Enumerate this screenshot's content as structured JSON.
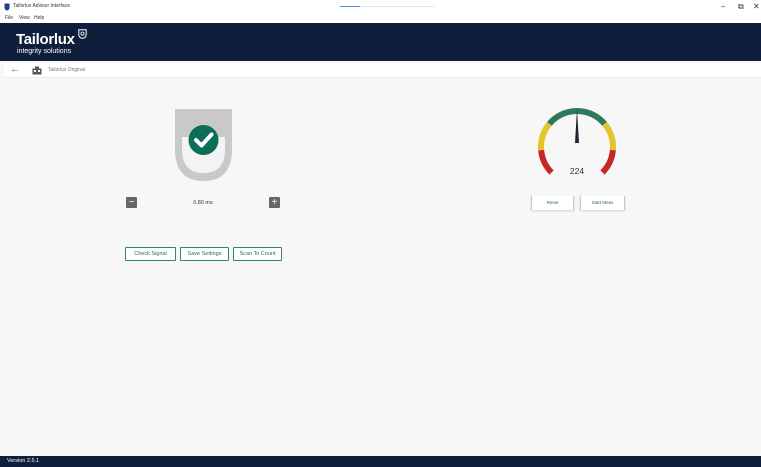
{
  "window": {
    "title": "Tailorlux Advisor Interface",
    "minimize_glyph": "–",
    "restore_glyph": "⧉",
    "close_glyph": "✕"
  },
  "menu": {
    "items": [
      {
        "label": "File"
      },
      {
        "label": "View"
      },
      {
        "label": "Help"
      }
    ]
  },
  "brand": {
    "name": "Tailorlux",
    "tagline": "integrity solutions",
    "color": "#0f1e3a"
  },
  "breadcrumb": {
    "back_glyph": "←",
    "device_label": "Tailorlux Original"
  },
  "status_indicator": {
    "state": "check-ok",
    "accent_color": "#0d6e57"
  },
  "stepper": {
    "minus_glyph": "−",
    "plus_glyph": "+",
    "value": "0.80 ms"
  },
  "gauge": {
    "value": 224,
    "value_label": "224",
    "needle_fraction": 0.5,
    "zones": [
      "#c62828",
      "#e2c52a",
      "#2d7a5a",
      "#e2c52a",
      "#c62828"
    ]
  },
  "gauge_actions": {
    "reset_label": "Reset",
    "start_label": "Start Meas"
  },
  "actions": {
    "check_signal_label": "Check Signal",
    "save_settings_label": "Save Settings",
    "scan_to_count_label": "Scan To Count"
  },
  "footer": {
    "version": "Version 2.5.1"
  }
}
